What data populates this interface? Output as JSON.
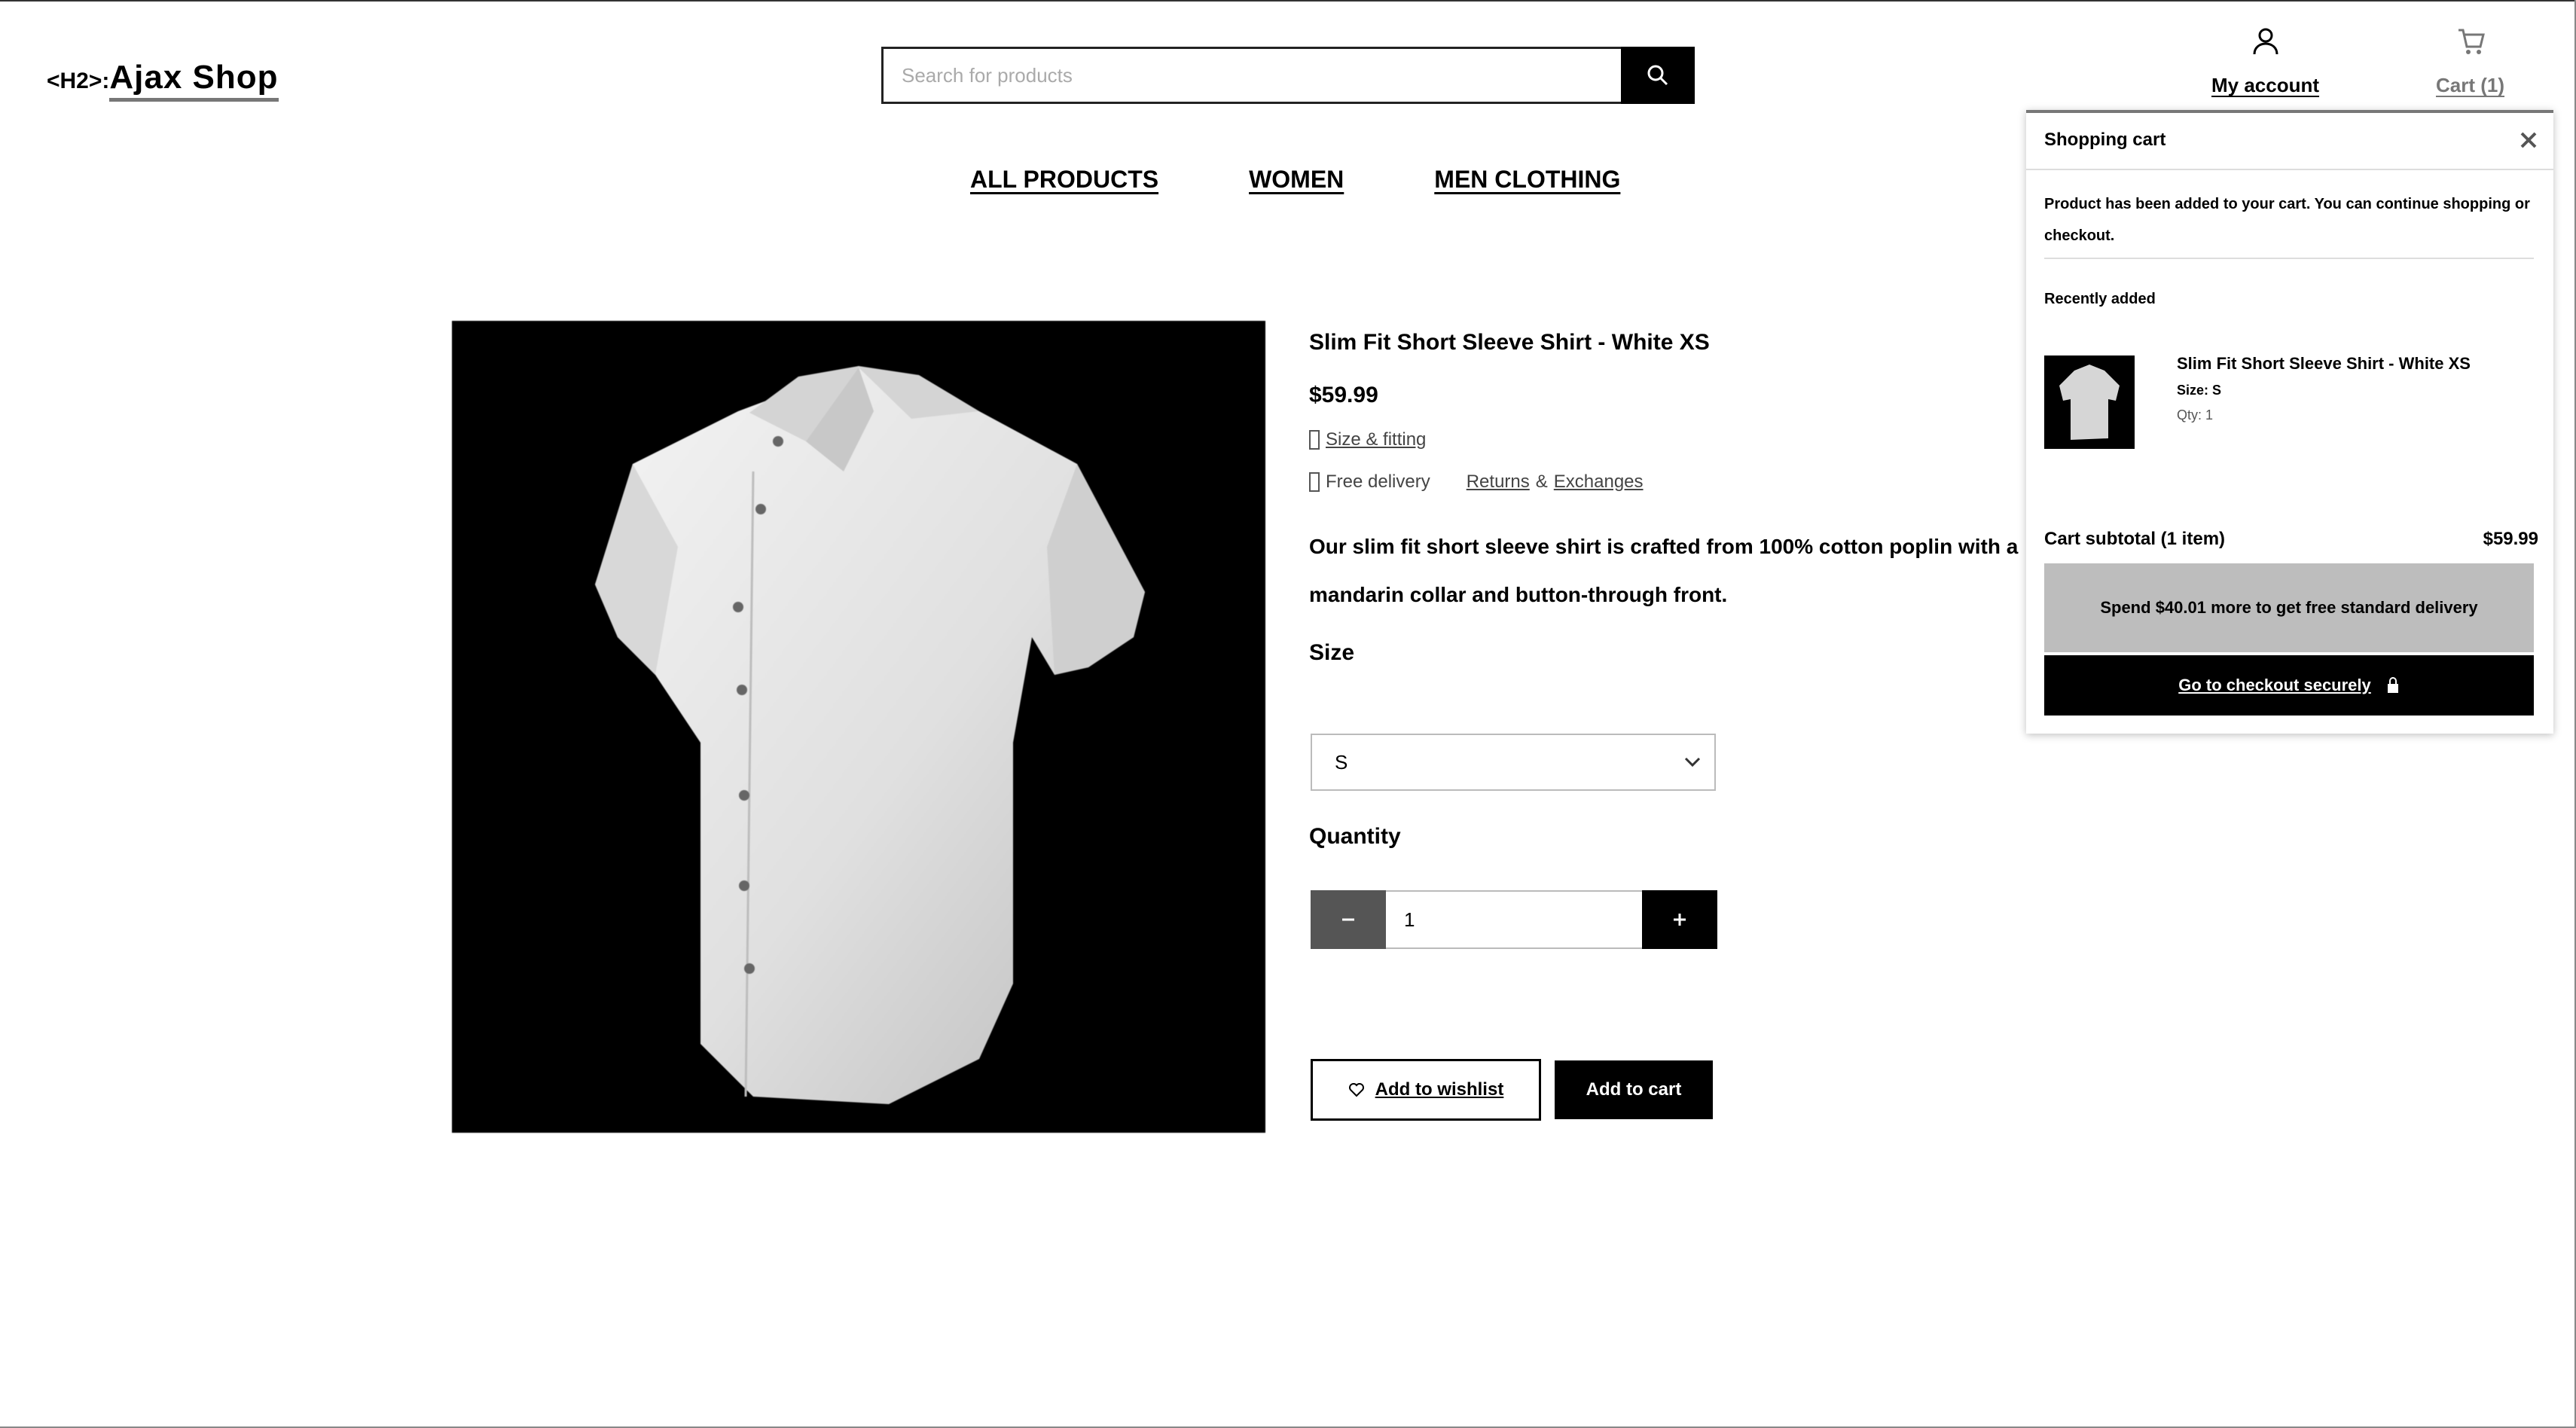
{
  "header": {
    "logo_prefix": "<H2>:",
    "logo_name": "Ajax Shop",
    "search_placeholder": "Search for products",
    "account_label": "My account",
    "cart_label": "Cart (1)"
  },
  "nav": {
    "items": [
      {
        "label": "ALL PRODUCTS"
      },
      {
        "label": "WOMEN"
      },
      {
        "label": "MEN CLOTHING"
      }
    ]
  },
  "product": {
    "title": "Slim Fit Short Sleeve Shirt - White XS",
    "price": "$59.99",
    "size_guide": "Size & fitting",
    "delivery_prefix": "Free delivery",
    "delivery_link1": "Returns",
    "delivery_amp": "&",
    "delivery_link2": "Exchanges",
    "description": "Our slim fit short sleeve shirt is crafted from 100% cotton poplin with a mandarin collar and button-through front.",
    "size_label": "Size",
    "size_value": "S",
    "quantity_label": "Quantity",
    "quantity_value": "1",
    "wishlist_label": "Add to wishlist",
    "add_to_cart_label": "Add to cart"
  },
  "cart_dropdown": {
    "title": "Shopping cart",
    "message": "Product has been added to your cart. You can continue shopping or checkout.",
    "recent_label": "Recently added",
    "item_name": "Slim Fit Short Sleeve Shirt - White XS",
    "item_size": "Size: S",
    "item_qty": "Qty: 1",
    "subtotal_label": "Cart subtotal (1 item)",
    "subtotal_value": "$59.99",
    "note_prefix": "Spend",
    "note_amount": "$40.01",
    "note_suffix": "more to get free standard delivery",
    "checkout_label": "Go to checkout securely"
  },
  "icons": [
    "search-icon",
    "user-icon",
    "cart-icon",
    "close-icon",
    "ruler-icon",
    "truck-icon",
    "minus-icon",
    "plus-icon",
    "heart-icon",
    "lock-icon",
    "chevron-down-icon"
  ]
}
